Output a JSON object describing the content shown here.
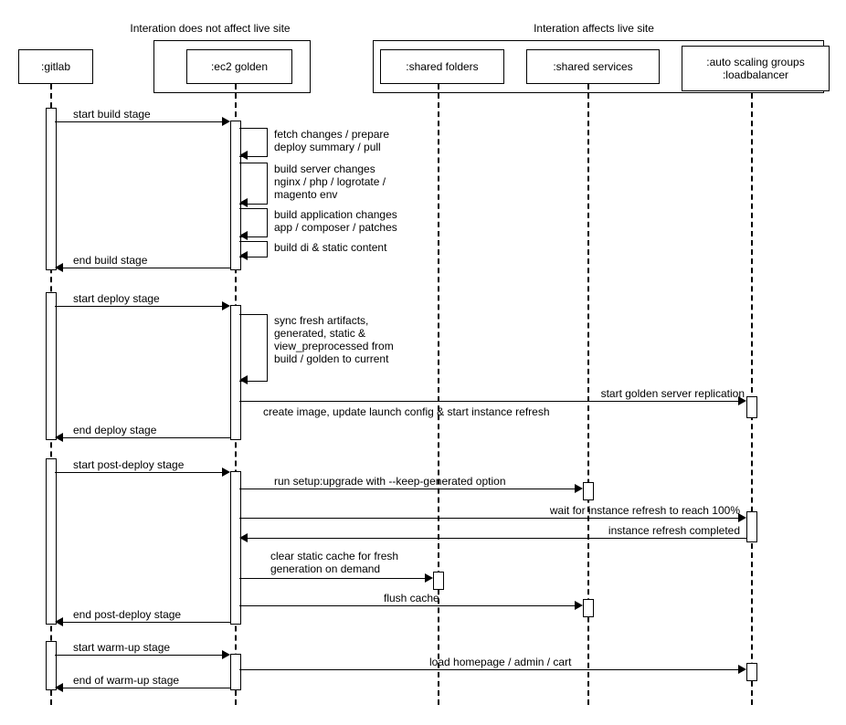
{
  "groups": {
    "left_label": "Interation does not affect live site",
    "right_label": "Interation affects live site"
  },
  "participants": {
    "gitlab": ":gitlab",
    "ec2": ":ec2 golden",
    "folders": ":shared folders",
    "services": ":shared services",
    "asg": ":auto scaling groups\n:loadbalancer"
  },
  "messages": {
    "m1": "start build stage",
    "m2": "fetch changes / prepare\ndeploy summary / pull",
    "m3": "build server changes\nnginx / php / logrotate /\nmagento env",
    "m4": "build application changes\napp / composer / patches",
    "m5": "build di & static content",
    "m6": "end build stage",
    "m7": "start deploy stage",
    "m8": "sync fresh artifacts,\ngenerated, static &\nview_preprocessed from\nbuild / golden to current",
    "m9": "start golden server replication",
    "m10": "create image, update launch config & start instance refresh",
    "m11": "end deploy stage",
    "m12": "start post-deploy stage",
    "m13": "run setup:upgrade with --keep-generated option",
    "m14": "wait for instance refresh to reach 100%",
    "m15": "instance refresh completed",
    "m16": "clear static cache for fresh\ngeneration on demand",
    "m17": "flush cache",
    "m18": "end post-deploy stage",
    "m19": "start warm-up stage",
    "m20": "load homepage / admin / cart",
    "m21": "end of warm-up stage"
  },
  "chart_data": {
    "type": "sequence-diagram",
    "groups": [
      {
        "label": "Interation does not affect live site",
        "participants": [
          "gitlab",
          "ec2"
        ]
      },
      {
        "label": "Interation affects live site",
        "participants": [
          "folders",
          "services",
          "asg"
        ]
      }
    ],
    "participants": [
      {
        "id": "gitlab",
        "label": ":gitlab"
      },
      {
        "id": "ec2",
        "label": ":ec2 golden"
      },
      {
        "id": "folders",
        "label": ":shared folders"
      },
      {
        "id": "services",
        "label": ":shared services"
      },
      {
        "id": "asg",
        "label": ":auto scaling groups :loadbalancer"
      }
    ],
    "messages": [
      {
        "from": "gitlab",
        "to": "ec2",
        "text": "start build stage"
      },
      {
        "from": "ec2",
        "to": "ec2",
        "text": "fetch changes / prepare deploy summary / pull"
      },
      {
        "from": "ec2",
        "to": "ec2",
        "text": "build server changes nginx / php / logrotate / magento env"
      },
      {
        "from": "ec2",
        "to": "ec2",
        "text": "build application changes app / composer / patches"
      },
      {
        "from": "ec2",
        "to": "ec2",
        "text": "build di & static content"
      },
      {
        "from": "ec2",
        "to": "gitlab",
        "text": "end build stage"
      },
      {
        "from": "gitlab",
        "to": "ec2",
        "text": "start deploy stage"
      },
      {
        "from": "ec2",
        "to": "ec2",
        "text": "sync fresh artifacts, generated, static & view_preprocessed from build / golden to current"
      },
      {
        "from": "ec2",
        "to": "asg",
        "text": "start golden server replication"
      },
      {
        "from": "asg",
        "to": "asg",
        "note": "create image, update launch config & start instance refresh"
      },
      {
        "from": "ec2",
        "to": "gitlab",
        "text": "end deploy stage"
      },
      {
        "from": "gitlab",
        "to": "ec2",
        "text": "start post-deploy stage"
      },
      {
        "from": "ec2",
        "to": "services",
        "text": "run setup:upgrade with --keep-generated option"
      },
      {
        "from": "ec2",
        "to": "asg",
        "text": "wait for instance refresh to reach 100%"
      },
      {
        "from": "asg",
        "to": "ec2",
        "text": "instance refresh completed"
      },
      {
        "from": "ec2",
        "to": "folders",
        "text": "clear static cache for fresh generation on demand"
      },
      {
        "from": "ec2",
        "to": "services",
        "text": "flush cache"
      },
      {
        "from": "ec2",
        "to": "gitlab",
        "text": "end post-deploy stage"
      },
      {
        "from": "gitlab",
        "to": "ec2",
        "text": "start warm-up stage"
      },
      {
        "from": "ec2",
        "to": "asg",
        "text": "load homepage / admin / cart"
      },
      {
        "from": "ec2",
        "to": "gitlab",
        "text": "end of warm-up stage"
      }
    ]
  }
}
